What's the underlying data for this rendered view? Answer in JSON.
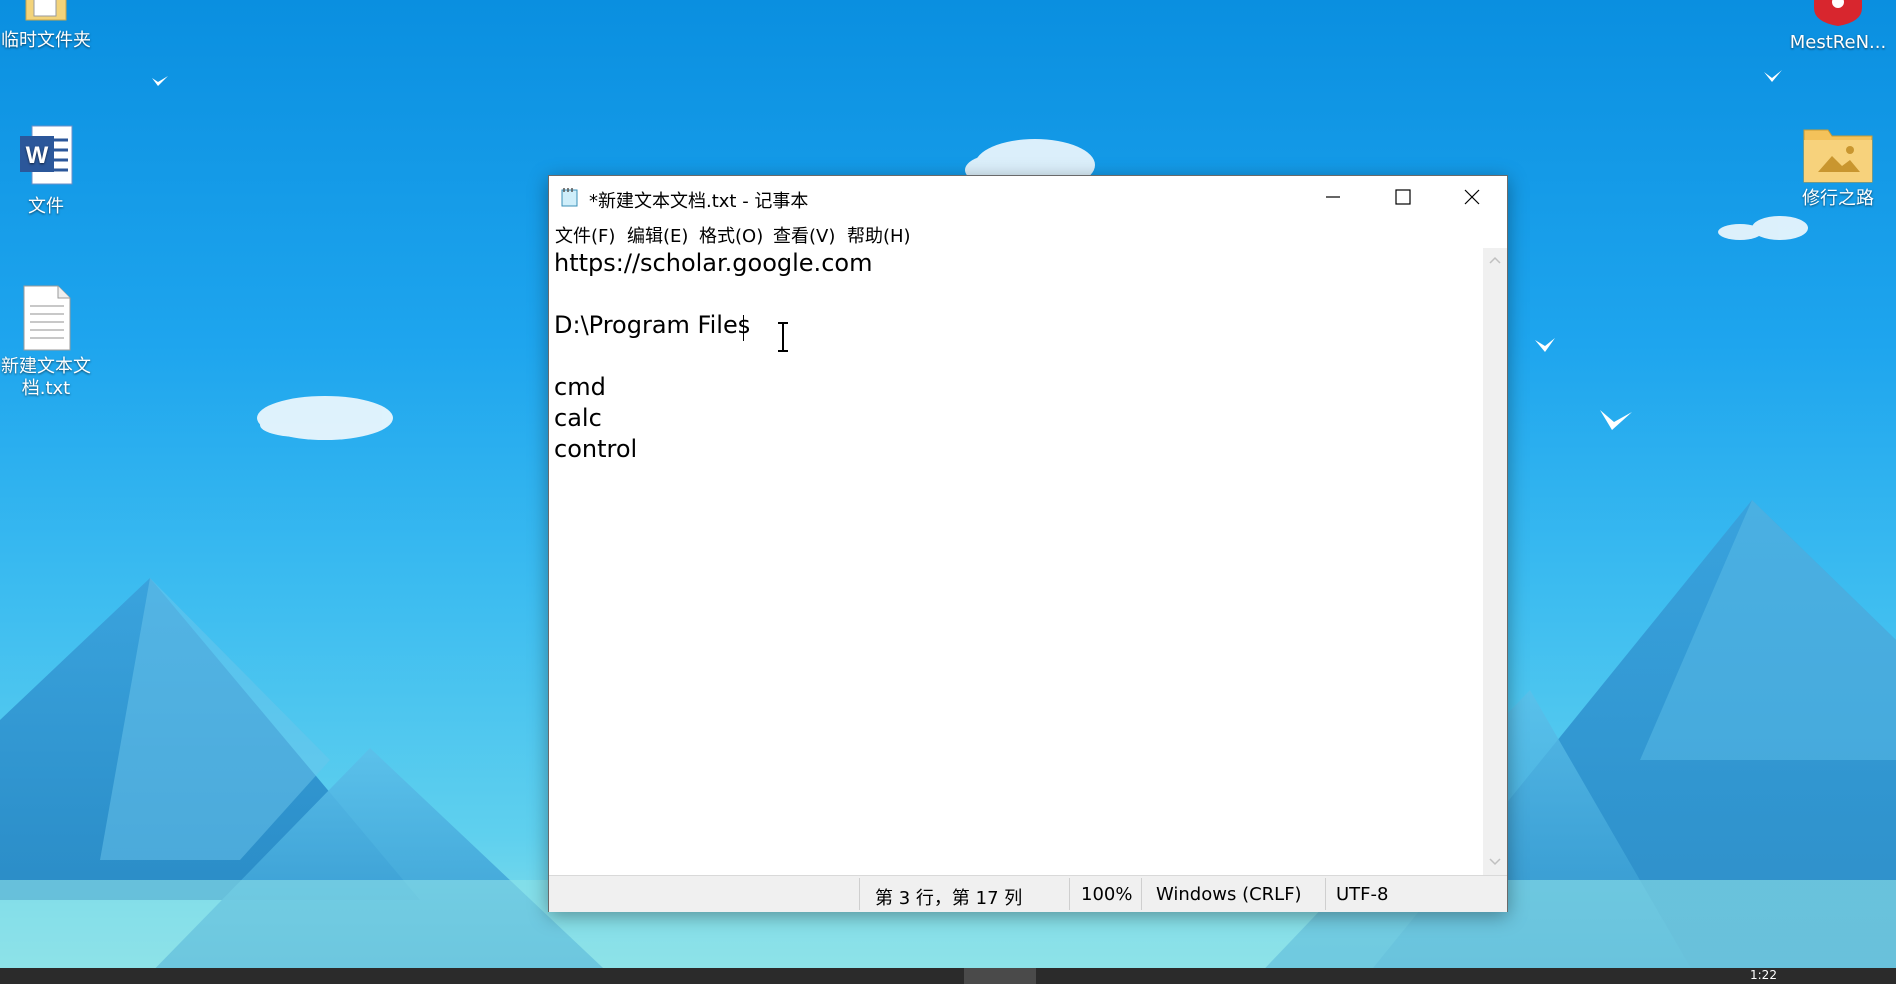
{
  "desktop": {
    "icons": [
      {
        "label": "临时文件夹"
      },
      {
        "label": "文件"
      },
      {
        "label_line1": "新建文本文",
        "label_line2": "档.txt"
      },
      {
        "label": "MestReN..."
      },
      {
        "label": "修行之路"
      }
    ]
  },
  "notepad": {
    "title": "*新建文本文档.txt - 记事本",
    "menu": [
      "文件(F)",
      "编辑(E)",
      "格式(O)",
      "查看(V)",
      "帮助(H)"
    ],
    "lines": [
      "https://scholar.google.com",
      "",
      "D:\\Program Files",
      "",
      "cmd",
      "calc",
      "control"
    ],
    "status": {
      "position": "第 3 行，第 17 列",
      "zoom": "100%",
      "line_ending": "Windows (CRLF)",
      "encoding": "UTF-8"
    }
  },
  "taskbar": {
    "clock": "1:22"
  },
  "colors": {
    "sky": "#1ea5ee",
    "mountain": "#2c8fcf",
    "taskbar": "#2b2b2b",
    "statusbar": "#f0f0f0"
  }
}
